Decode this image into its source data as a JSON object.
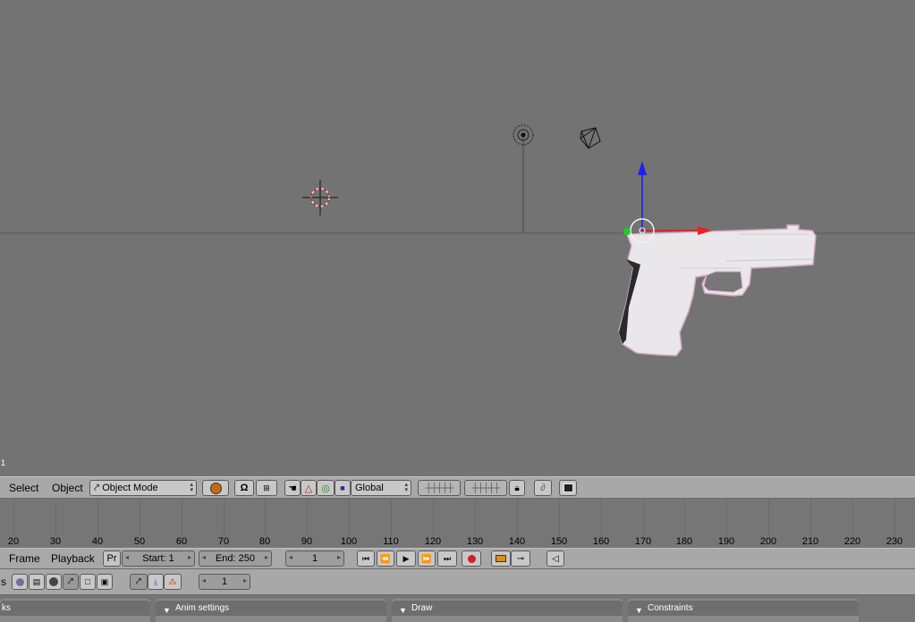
{
  "viewport": {
    "frame_indicator": "1"
  },
  "header": {
    "menus": [
      "Select",
      "Object"
    ],
    "mode": "Object Mode",
    "orientation": "Global",
    "icons": [
      "object-mode-icon",
      "pivot-icon",
      "snap-icon",
      "manipulator-icon",
      "hand-icon",
      "translate-icon",
      "rotate-icon",
      "scale-icon",
      "layers-grid-icon",
      "lock-icon",
      "render-icon"
    ]
  },
  "timeline": {
    "ruler_labels": [
      "20",
      "30",
      "40",
      "50",
      "60",
      "70",
      "80",
      "90",
      "100",
      "110",
      "120",
      "130",
      "140",
      "150",
      "160",
      "170",
      "180",
      "190",
      "200",
      "210",
      "220",
      "230"
    ]
  },
  "timeline_header": {
    "menus": [
      "Frame",
      "Playback"
    ],
    "pr_label": "Pr",
    "start": "Start: 1",
    "end": "End: 250",
    "current_frame": "1"
  },
  "buttons_header": {
    "left_label": "s",
    "frame": "1"
  },
  "panels": {
    "links_title": "ks",
    "anim_title": "Anim settings",
    "draw_title": "Draw",
    "constraints_title": "Constraints"
  }
}
